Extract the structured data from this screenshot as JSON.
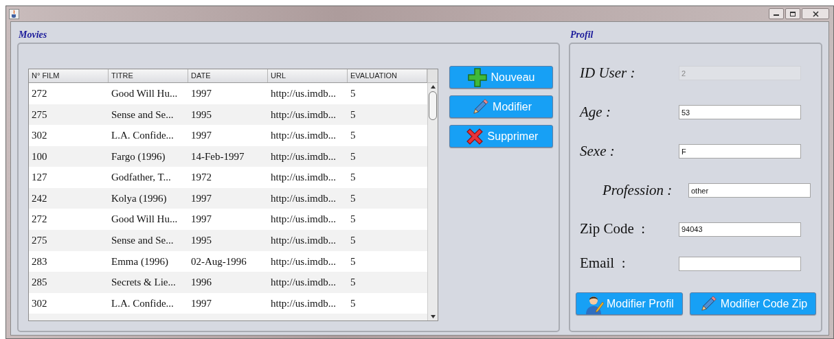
{
  "movies": {
    "title": "Movies",
    "table": {
      "columns": [
        "N° FILM",
        "TITRE",
        "DATE",
        "URL",
        "EVALUATION"
      ],
      "rows": [
        [
          "272",
          "Good Will Hu...",
          "1997",
          "http://us.imdb...",
          "5"
        ],
        [
          "275",
          "Sense and Se...",
          "1995",
          "http://us.imdb...",
          "5"
        ],
        [
          "302",
          "L.A. Confide...",
          "1997",
          "http://us.imdb...",
          "5"
        ],
        [
          "100",
          "Fargo (1996)",
          "14-Feb-1997",
          "http://us.imdb...",
          "5"
        ],
        [
          "127",
          "Godfather, T...",
          "1972",
          "http://us.imdb...",
          "5"
        ],
        [
          "242",
          "Kolya (1996)",
          "1997",
          "http://us.imdb...",
          "5"
        ],
        [
          "272",
          "Good Will Hu...",
          "1997",
          "http://us.imdb...",
          "5"
        ],
        [
          "275",
          "Sense and Se...",
          "1995",
          "http://us.imdb...",
          "5"
        ],
        [
          "283",
          "Emma (1996)",
          "02-Aug-1996",
          "http://us.imdb...",
          "5"
        ],
        [
          "285",
          "Secrets & Lie...",
          "1996",
          "http://us.imdb...",
          "5"
        ],
        [
          "302",
          "L.A. Confide...",
          "1997",
          "http://us.imdb...",
          "5"
        ]
      ]
    },
    "buttons": [
      {
        "label": "Nouveau",
        "kind": "add"
      },
      {
        "label": "Modifier",
        "kind": "edit"
      },
      {
        "label": "Supprimer",
        "kind": "delete"
      }
    ]
  },
  "profil": {
    "title": "Profil",
    "fields": [
      {
        "label": "ID User :",
        "value": "2",
        "disabled": true,
        "kind": "italic"
      },
      {
        "label": "Age :",
        "value": "53",
        "disabled": false,
        "kind": "italic"
      },
      {
        "label": "Sexe :",
        "value": "F",
        "disabled": false,
        "kind": "italic"
      },
      {
        "label": "Profession :",
        "value": "other",
        "disabled": false,
        "kind": "indented"
      },
      {
        "label": "Zip Code  :",
        "value": "94043",
        "disabled": false,
        "kind": "plain"
      },
      {
        "label": "Email  :",
        "disabled": false,
        "kind": "plain"
      }
    ],
    "buttons": [
      {
        "label": "Modifier Profil",
        "kind": "user-edit"
      },
      {
        "label": "Modifier Code Zip",
        "kind": "edit"
      }
    ]
  }
}
